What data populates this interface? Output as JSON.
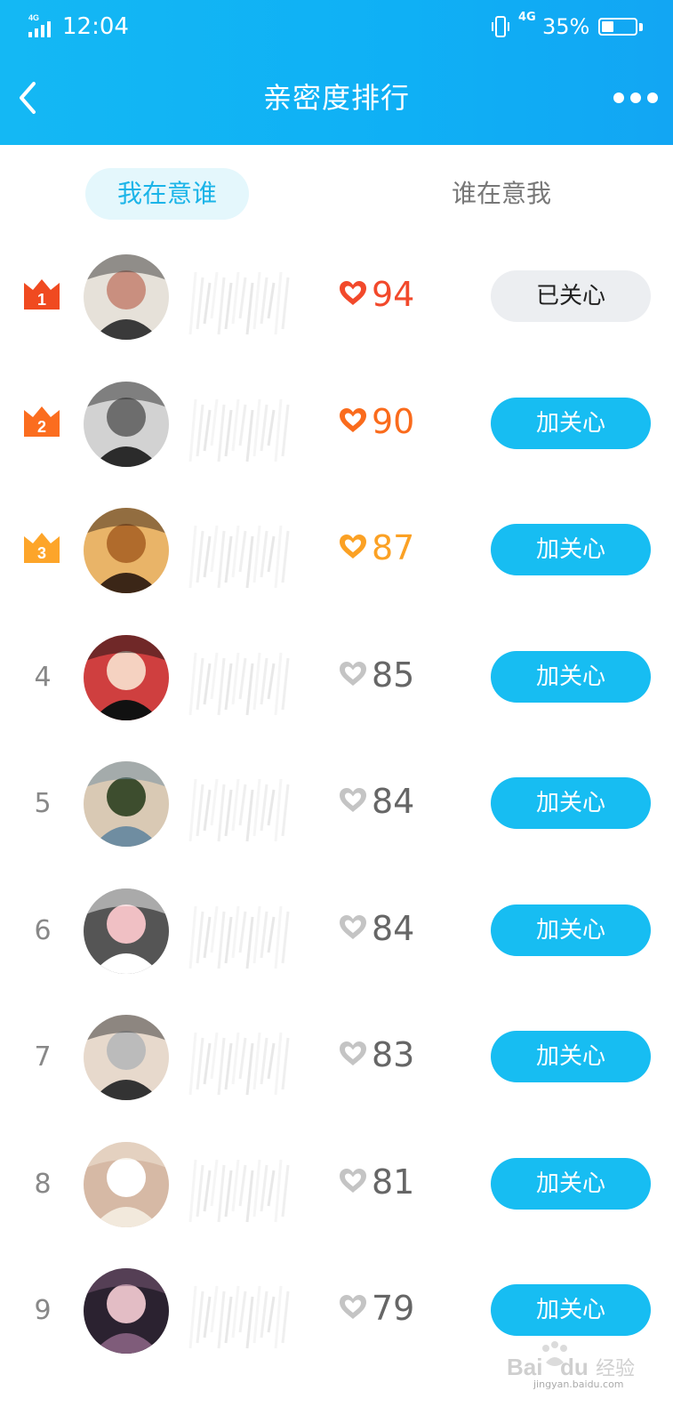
{
  "status_bar": {
    "network": "4G",
    "time": "12:04",
    "data_network": "4G",
    "battery_percent": "35%",
    "battery_level": 0.35
  },
  "nav": {
    "title": "亲密度排行",
    "back_icon": "chevron-left-icon",
    "more_icon": "more-horizontal-icon"
  },
  "tabs": [
    {
      "label": "我在意谁",
      "active": true
    },
    {
      "label": "谁在意我",
      "active": false
    }
  ],
  "ranking": [
    {
      "rank": "1",
      "score": "94",
      "button": "已关心",
      "followed": true,
      "heart_color": "#f2492b",
      "crown_color": "#f04a20",
      "avatar_colors": [
        "#3a3a3a",
        "#c98f7f",
        "#e6e1d9"
      ]
    },
    {
      "rank": "2",
      "score": "90",
      "button": "加关心",
      "followed": false,
      "heart_color": "#fa6b1c",
      "crown_color": "#fb6d1f",
      "avatar_colors": [
        "#2b2b2b",
        "#6d6d6d",
        "#d2d2d2"
      ]
    },
    {
      "rank": "3",
      "score": "87",
      "button": "加关心",
      "followed": false,
      "heart_color": "#fba124",
      "crown_color": "#fda52a",
      "avatar_colors": [
        "#3b2617",
        "#b06b2c",
        "#e9b468"
      ]
    },
    {
      "rank": "4",
      "score": "85",
      "button": "加关心",
      "followed": false,
      "heart_color": "#c4c4c4",
      "avatar_colors": [
        "#111111",
        "#f5d2c1",
        "#cf3f3f"
      ]
    },
    {
      "rank": "5",
      "score": "84",
      "button": "加关心",
      "followed": false,
      "heart_color": "#c4c4c4",
      "avatar_colors": [
        "#6f8da1",
        "#3d4d2e",
        "#d9c9b4"
      ]
    },
    {
      "rank": "6",
      "score": "84",
      "button": "加关心",
      "followed": false,
      "heart_color": "#c4c4c4",
      "avatar_colors": [
        "#ffffff",
        "#f0c0c4",
        "#555555"
      ]
    },
    {
      "rank": "7",
      "score": "83",
      "button": "加关心",
      "followed": false,
      "heart_color": "#c4c4c4",
      "avatar_colors": [
        "#333333",
        "#bbbbbb",
        "#e7d9cc"
      ]
    },
    {
      "rank": "8",
      "score": "81",
      "button": "加关心",
      "followed": false,
      "heart_color": "#c4c4c4",
      "avatar_colors": [
        "#f2e9dc",
        "#ffffff",
        "#d6b9a5"
      ]
    },
    {
      "rank": "9",
      "score": "79",
      "button": "加关心",
      "followed": false,
      "heart_color": "#c4c4c4",
      "avatar_colors": [
        "#7f5c7a",
        "#e3bdc5",
        "#2b2230"
      ]
    }
  ],
  "colors": {
    "header": "#14b8f4",
    "accent": "#17bdf2",
    "tab_active_bg": "#e4f7fc",
    "score_gray": "#666666"
  },
  "watermark": {
    "logo": "Baidu经验",
    "url": "jingyan.baidu.com"
  }
}
